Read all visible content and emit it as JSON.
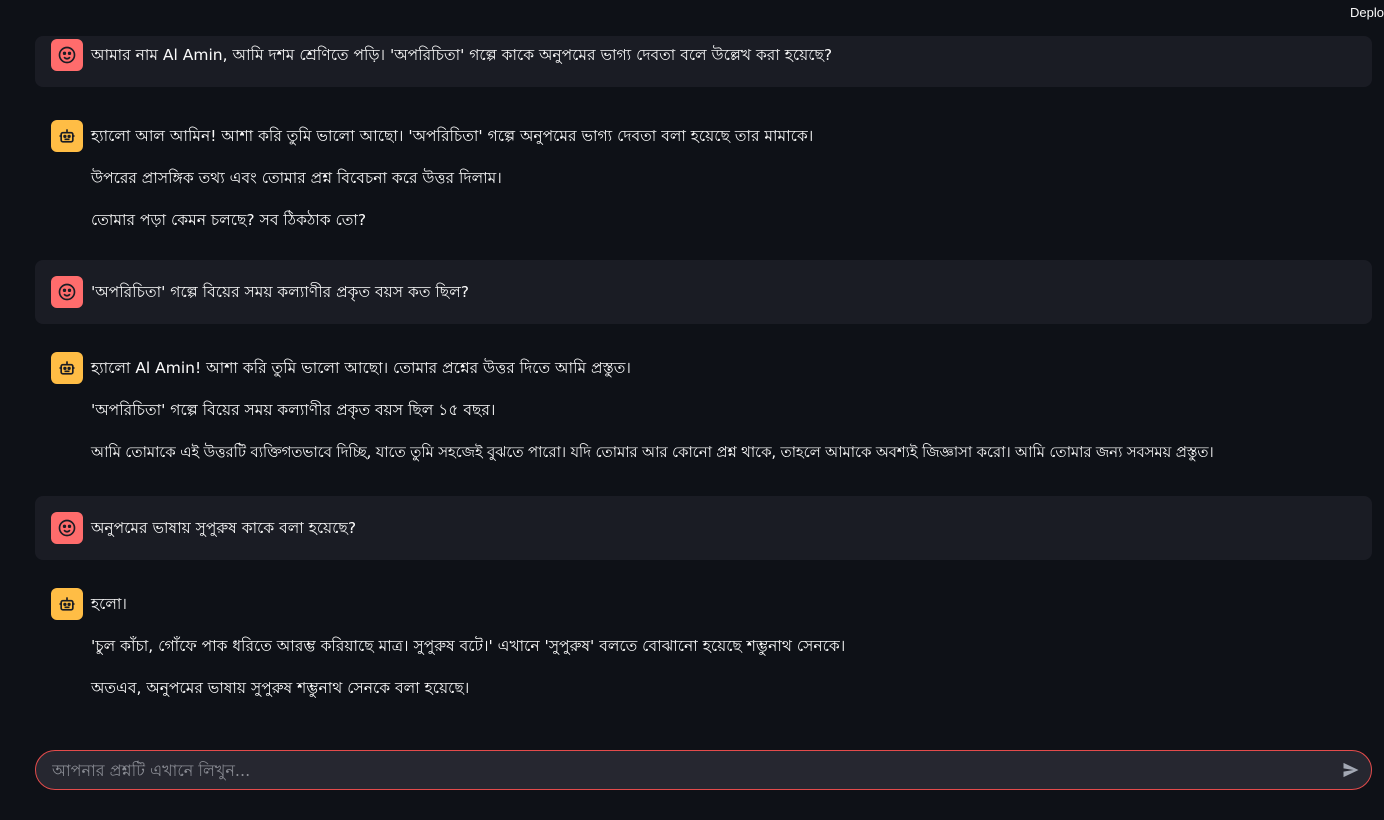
{
  "header": {
    "deploy_label": "Deploy"
  },
  "messages": [
    {
      "role": "user",
      "lines": [
        "আমার নাম Al Amin, আমি দশম শ্রেণিতে পড়ি। 'অপরিচিতা' গল্পে কাকে অনুপমের ভাগ্য দেবতা বলে উল্লেখ করা হয়েছে?"
      ]
    },
    {
      "role": "assistant",
      "lines": [
        "হ্যালো আল আমিন! আশা করি তুমি ভালো আছো। 'অপরিচিতা' গল্পে অনুপমের ভাগ্য দেবতা বলা হয়েছে তার মামাকে।",
        "উপরের প্রাসঙ্গিক তথ্য এবং তোমার প্রশ্ন বিবেচনা করে উত্তর দিলাম।",
        "তোমার পড়া কেমন চলছে? সব ঠিকঠাক তো?"
      ]
    },
    {
      "role": "user",
      "lines": [
        "'অপরিচিতা' গল্পে বিয়ের সময় কল্যাণীর প্রকৃত বয়স কত ছিল?"
      ]
    },
    {
      "role": "assistant",
      "lines": [
        "হ্যালো Al Amin! আশা করি তুমি ভালো আছো। তোমার প্রশ্নের উত্তর দিতে আমি প্রস্তুত।",
        "'অপরিচিতা' গল্পে বিয়ের সময় কল্যাণীর প্রকৃত বয়স ছিল ১৫ বছর।",
        "আমি তোমাকে এই উত্তরটি ব্যক্তিগতভাবে দিচ্ছি, যাতে তুমি সহজেই বুঝতে পারো। যদি তোমার আর কোনো প্রশ্ন থাকে, তাহলে আমাকে অবশ্যই জিজ্ঞাসা করো। আমি তোমার জন্য সবসময় প্রস্তুত।"
      ]
    },
    {
      "role": "user",
      "lines": [
        "অনুপমের ভাষায় সুপুরুষ কাকে বলা হয়েছে?"
      ]
    },
    {
      "role": "assistant",
      "lines": [
        "হলো।",
        "'চুল কাঁচা, গোঁফে পাক ধরিতে আরম্ভ করিয়াছে মাত্র। সুপুরুষ বটে।' এখানে 'সুপুরুষ' বলতে বোঝানো হয়েছে শম্ভুনাথ সেনকে।",
        "অতএব, অনুপমের ভাষায় সুপুরুষ শম্ভুনাথ সেনকে বলা হয়েছে।"
      ]
    }
  ],
  "chat_input": {
    "placeholder": "আপনার প্রশ্নটি এখানে লিখুন...",
    "value": ""
  },
  "icons": {
    "user_avatar": "smiley-face-icon",
    "assistant_avatar": "robot-icon",
    "send": "send-arrow-icon"
  },
  "colors": {
    "background": "#0e1117",
    "user_message_bg": "#1a1c24",
    "user_avatar": "#ff6c6c",
    "assistant_avatar": "#ffbd45",
    "input_border": "#e34b4b"
  }
}
